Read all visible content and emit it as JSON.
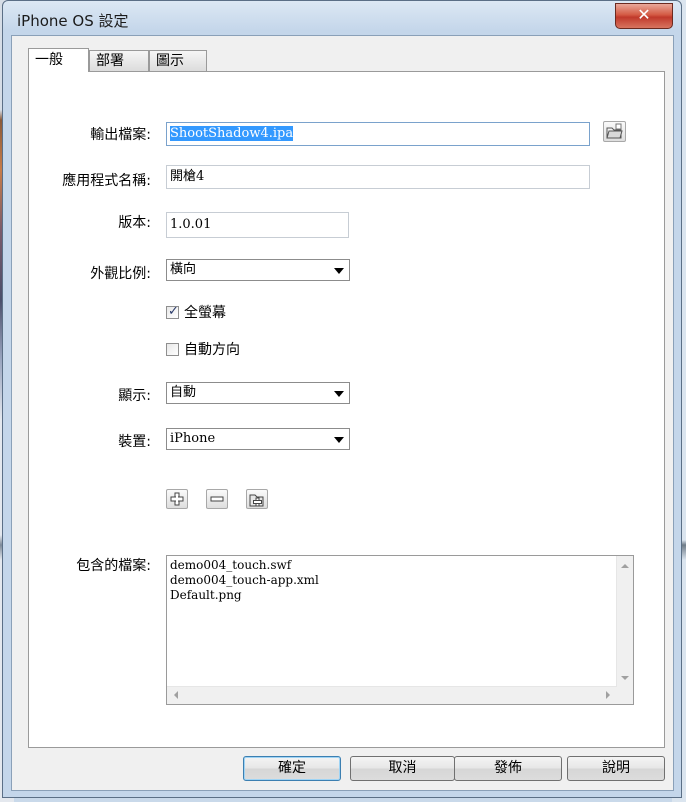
{
  "window": {
    "title": "iPhone OS 設定",
    "close_glyph": "✕"
  },
  "tabs": [
    {
      "label": "一般",
      "active": true
    },
    {
      "label": "部署",
      "active": false
    },
    {
      "label": "圖示",
      "active": false
    }
  ],
  "general": {
    "output_file": {
      "label": "輸出檔案:",
      "value": "ShootShadow4.ipa",
      "browse_icon": "folder-browse-icon"
    },
    "app_name": {
      "label": "應用程式名稱:",
      "value": "開槍4"
    },
    "version": {
      "label": "版本:",
      "value": "1.0.01"
    },
    "aspect_ratio": {
      "label": "外觀比例:",
      "selected": "橫向"
    },
    "full_screen": {
      "label": "全螢幕",
      "checked": true
    },
    "auto_orientation": {
      "label": "自動方向",
      "checked": false
    },
    "rendering": {
      "label": "顯示:",
      "selected": "自動"
    },
    "device": {
      "label": "裝置:",
      "selected": "iPhone"
    },
    "included_files": {
      "label": "包含的檔案:",
      "buttons": [
        "add-file-icon",
        "remove-file-icon",
        "add-folder-icon"
      ],
      "items": [
        "demo004_touch.swf",
        "demo004_touch-app.xml",
        "Default.png"
      ]
    }
  },
  "footer": {
    "ok": "確定",
    "cancel": "取消",
    "publish": "發佈",
    "help": "說明"
  }
}
